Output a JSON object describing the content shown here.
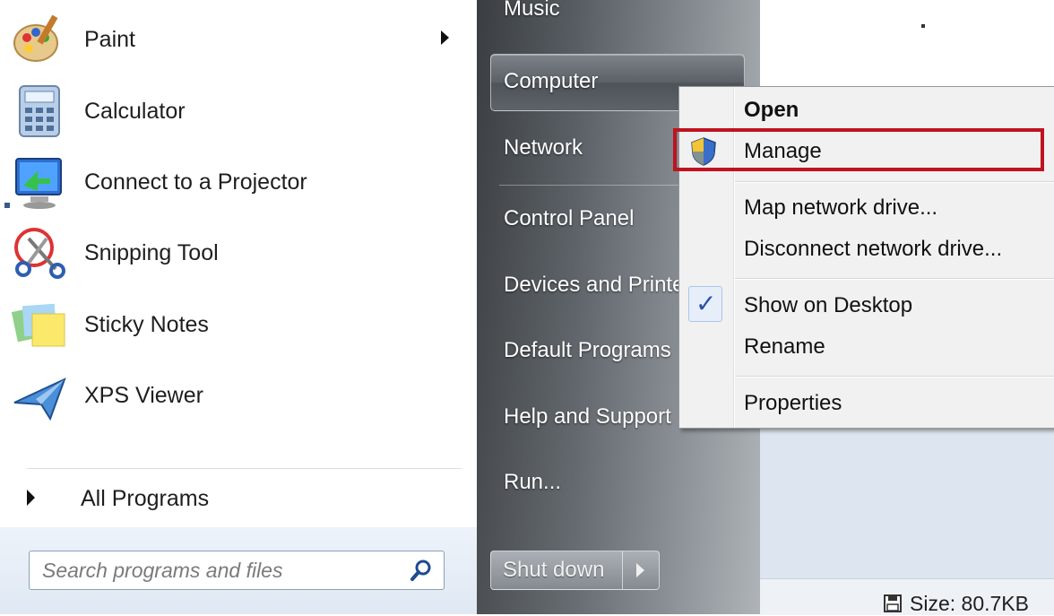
{
  "programs": [
    {
      "label": "Paint",
      "icon": "paint-icon",
      "has_submenu": true
    },
    {
      "label": "Calculator",
      "icon": "calculator-icon"
    },
    {
      "label": "Connect to a Projector",
      "icon": "projector-icon"
    },
    {
      "label": "Snipping Tool",
      "icon": "scissors-icon"
    },
    {
      "label": "Sticky Notes",
      "icon": "sticky-notes-icon"
    },
    {
      "label": "XPS Viewer",
      "icon": "xps-viewer-icon"
    }
  ],
  "all_programs": "All Programs",
  "search": {
    "placeholder": "Search programs and files",
    "icon": "search-icon"
  },
  "right_pane": {
    "items": [
      "Music",
      "Computer",
      "Network",
      "Control Panel",
      "Devices and Printe",
      "Default Programs",
      "Help and Support",
      "Run..."
    ],
    "shutdown_label": "Shut down"
  },
  "context_menu": {
    "items": [
      {
        "label": "Open",
        "bold": true
      },
      {
        "label": "Manage",
        "icon": "uac-shield-icon",
        "highlighted": true
      },
      {
        "label": "Map network drive..."
      },
      {
        "label": "Disconnect network drive..."
      },
      {
        "label": "Show on Desktop",
        "checked": true,
        "check_glyph": "✓"
      },
      {
        "label": "Rename"
      },
      {
        "label": "Properties"
      }
    ]
  },
  "status_bar": {
    "size_text": "Size: 80.7KB",
    "icon": "disk-icon"
  },
  "colors": {
    "highlight_border": "#c0121f",
    "check": "#2b4fa8"
  }
}
